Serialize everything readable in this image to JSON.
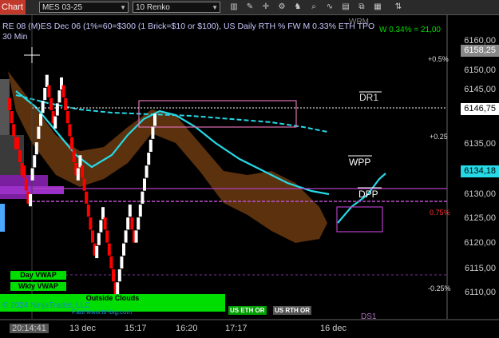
{
  "toolbar": {
    "chart_tab": "Chart",
    "instrument": "MES 03-25",
    "bar_type": "10 Renko",
    "icons": [
      "bar-style-icon",
      "draw-tool-icon",
      "crosshair-icon",
      "properties-icon",
      "strategy-icon",
      "search-icon",
      "indicator-icon",
      "template-icon",
      "overlay-icon",
      "alert-icon",
      "order-icon"
    ]
  },
  "chart": {
    "title_line1": "RE 08 (M)ES Dec 06 (1%=60=$300  (1 Brick=$10 or $100), US Daily RTH % FW M 0.33% ETH TPO",
    "title_line2": "30 Min",
    "overlay_right": "W 0.34% = 21,00",
    "overlay_top": "WRM",
    "labels": {
      "dr1": "DR1",
      "wpp": "WPP",
      "dpp": "DPP",
      "ds1": "DS1"
    },
    "price_labels": [
      "6160,00",
      "6150,00",
      "6145,00",
      "6140,00",
      "6135,00",
      "6130,00",
      "6125,00",
      "6120,00",
      "6115,00",
      "6110,00"
    ],
    "price_tags": {
      "top": "6158,25",
      "last": "6146,75",
      "cyan": "6134,18"
    },
    "pct_labels": {
      "p05": "+0.5%",
      "p025": "+0.25",
      "m075": "0.75%",
      "m025": "-0.25%"
    },
    "time_labels": [
      "20:14:41",
      "13 dec",
      "15:17",
      "16:20",
      "17:17",
      "16 dec"
    ],
    "buttons": {
      "day_vwap": "Day VWAP",
      "wkly_vwap": "Wkly VWAP",
      "outside_clouds": "Outside Clouds",
      "us_eth": "US ETH OR",
      "us_rth": "US RTH OR"
    },
    "copyright": "© 2024 NinjaTrader, LLC",
    "watermark": "Paul   www.ttr-blg.com",
    "colors": {
      "up": "#ffffff",
      "down": "#ff0000",
      "cyan": "#25d9e6",
      "cloud": "#6b3a10",
      "pivot": "#b040c0",
      "pink": "#e070b0",
      "green": "#00dd00"
    }
  },
  "chart_data": {
    "type": "renko",
    "brick_size": 2.5,
    "ylim": [
      6108,
      6165
    ],
    "columns": [
      {
        "dir": "down",
        "from": 6149,
        "to": 6139
      },
      {
        "dir": "down",
        "from": 6141.5,
        "to": 6133
      },
      {
        "dir": "down",
        "from": 6136,
        "to": 6128
      },
      {
        "dir": "up",
        "from": 6128,
        "to": 6131
      },
      {
        "dir": "up",
        "from": 6133,
        "to": 6141
      },
      {
        "dir": "up",
        "from": 6141,
        "to": 6154
      },
      {
        "dir": "down",
        "from": 6151.5,
        "to": 6143
      },
      {
        "dir": "up",
        "from": 6143,
        "to": 6154
      },
      {
        "dir": "down",
        "from": 6151.5,
        "to": 6133
      },
      {
        "dir": "up",
        "from": 6133,
        "to": 6138
      },
      {
        "dir": "down",
        "from": 6136,
        "to": 6118
      },
      {
        "dir": "up",
        "from": 6118,
        "to": 6128
      },
      {
        "dir": "down",
        "from": 6126,
        "to": 6111
      },
      {
        "dir": "up",
        "from": 6111,
        "to": 6128
      },
      {
        "dir": "down",
        "from": 6126,
        "to": 6121
      },
      {
        "dir": "up",
        "from": 6121,
        "to": 6146.5
      }
    ]
  }
}
